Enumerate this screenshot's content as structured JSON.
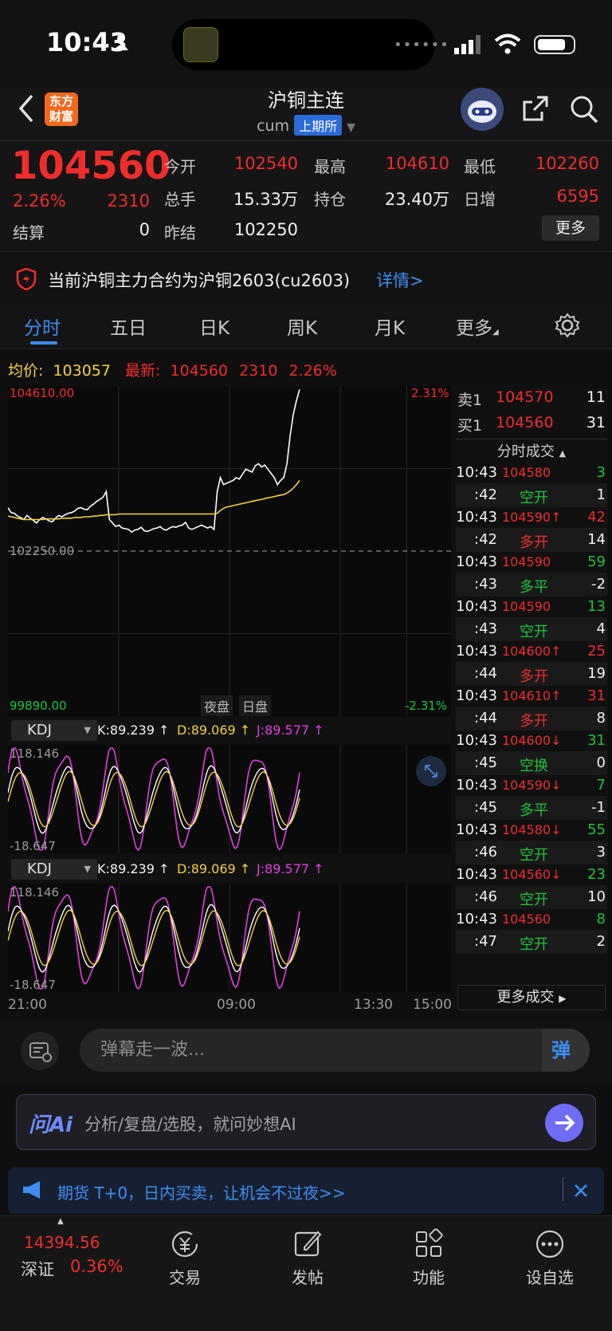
{
  "status_bar": {
    "time": "10:43"
  },
  "header": {
    "title": "沪铜主连",
    "code": "cum",
    "exchange": "上期所",
    "logo_text": "东方财富"
  },
  "quote": {
    "price": "104560",
    "change_pct": "2.26%",
    "change": "2310",
    "settle_label": "结算",
    "settle": "0",
    "fields": [
      {
        "label": "今开",
        "value": "102540"
      },
      {
        "label": "最高",
        "value": "104610"
      },
      {
        "label": "最低",
        "value": "102260"
      },
      {
        "label": "总手",
        "value": "15.33万"
      },
      {
        "label": "持仓",
        "value": "23.40万"
      },
      {
        "label": "日增",
        "value": "6595"
      },
      {
        "label": "昨结",
        "value": "102250"
      }
    ],
    "more_button": "更多"
  },
  "notice": {
    "text": "当前沪铜主力合约为沪铜2603(cu2603)",
    "link": "详情>"
  },
  "tabs": [
    "分时",
    "五日",
    "日K",
    "周K",
    "月K",
    "更多"
  ],
  "price_line": {
    "avg_label": "均价:",
    "avg_value": "103057",
    "latest_label": "最新:",
    "latest_value": "104560",
    "change": "2310",
    "pct": "2.26%"
  },
  "chart_data": {
    "type": "line",
    "y_top": "104610.00",
    "y_mid": "102250.00",
    "y_bottom": "99890.00",
    "pct_top": "2.31%",
    "pct_bottom": "-2.31%",
    "session_labels": [
      "夜盘",
      "日盘"
    ],
    "x_ticks": [
      "21:00",
      "09:00",
      "13:30",
      "15:00"
    ],
    "ylim": [
      99890,
      104610
    ],
    "series": [
      {
        "name": "price",
        "color": "#ffffff",
        "values": [
          102870,
          102800,
          102790,
          102750,
          102730,
          102700,
          102760,
          102720,
          102690,
          102650,
          102700,
          102730,
          102710,
          102680,
          102670,
          102720,
          102760,
          102740,
          102770,
          102790,
          102800,
          102820,
          102860,
          102870,
          102850,
          102840,
          102890,
          102920,
          102960,
          102990,
          103020,
          103100,
          102700,
          102650,
          102600,
          102620,
          102580,
          102570,
          102560,
          102520,
          102550,
          102560,
          102590,
          102540,
          102530,
          102550,
          102570,
          102580,
          102600,
          102560,
          102550,
          102580,
          102600,
          102590,
          102610,
          102620,
          102660,
          102580,
          102560,
          102580,
          102600,
          102620,
          102600,
          102580,
          102600,
          102560,
          103100,
          103300,
          103200,
          103220,
          103240,
          103260,
          103300,
          103280,
          103350,
          103420,
          103400,
          103380,
          103470,
          103500,
          103450,
          103480,
          103420,
          103360,
          103300,
          103200,
          103260,
          103300,
          103500,
          103900,
          104200,
          104400,
          104560
        ]
      },
      {
        "name": "avg",
        "color": "#f5d142",
        "values": [
          102750,
          102740,
          102730,
          102720,
          102710,
          102700,
          102700,
          102700,
          102700,
          102700,
          102700,
          102700,
          102710,
          102710,
          102710,
          102710,
          102710,
          102720,
          102720,
          102720,
          102720,
          102730,
          102730,
          102730,
          102740,
          102740,
          102740,
          102750,
          102750,
          102760,
          102760,
          102770,
          102770,
          102770,
          102770,
          102780,
          102780,
          102780,
          102780,
          102780,
          102780,
          102780,
          102780,
          102780,
          102780,
          102780,
          102780,
          102780,
          102780,
          102780,
          102780,
          102780,
          102780,
          102780,
          102780,
          102780,
          102780,
          102780,
          102780,
          102780,
          102780,
          102780,
          102780,
          102780,
          102780,
          102780,
          102790,
          102830,
          102860,
          102880,
          102890,
          102900,
          102910,
          102920,
          102930,
          102940,
          102950,
          102960,
          102970,
          102980,
          102990,
          103000,
          103010,
          103020,
          103030,
          103040,
          103050,
          103057,
          103080,
          103110,
          103150,
          103200,
          103260
        ]
      }
    ],
    "kdj": {
      "indicator": "KDJ",
      "k": "K:89.239 ↑",
      "d": "D:89.069 ↑",
      "j": "J:89.577 ↑",
      "top": "118.146",
      "bottom": "-18.647"
    }
  },
  "orderbook": [
    {
      "side": "卖1",
      "price": "104570",
      "vol": "11"
    },
    {
      "side": "买1",
      "price": "104560",
      "vol": "31"
    }
  ],
  "trades_title": "分时成交",
  "trades": [
    {
      "time": "10:43",
      "price": "104580",
      "vol": "3",
      "pcolor": "red",
      "vcolor": "green"
    },
    {
      "time": ":42",
      "tag": "空开",
      "vol": "1",
      "tcolor": "green",
      "vcolor": "white"
    },
    {
      "time": "10:43",
      "price": "104590↑",
      "vol": "42",
      "pcolor": "red",
      "vcolor": "red"
    },
    {
      "time": ":42",
      "tag": "多开",
      "vol": "14",
      "tcolor": "red",
      "vcolor": "white"
    },
    {
      "time": "10:43",
      "price": "104590",
      "vol": "59",
      "pcolor": "red",
      "vcolor": "green"
    },
    {
      "time": ":43",
      "tag": "多平",
      "vol": "-2",
      "tcolor": "green",
      "vcolor": "white"
    },
    {
      "time": "10:43",
      "price": "104590",
      "vol": "13",
      "pcolor": "red",
      "vcolor": "green"
    },
    {
      "time": ":43",
      "tag": "空开",
      "vol": "4",
      "tcolor": "green",
      "vcolor": "white"
    },
    {
      "time": "10:43",
      "price": "104600↑",
      "vol": "25",
      "pcolor": "red",
      "vcolor": "red"
    },
    {
      "time": ":44",
      "tag": "多开",
      "vol": "19",
      "tcolor": "red",
      "vcolor": "white"
    },
    {
      "time": "10:43",
      "price": "104610↑",
      "vol": "31",
      "pcolor": "red",
      "vcolor": "red"
    },
    {
      "time": ":44",
      "tag": "多开",
      "vol": "8",
      "tcolor": "red",
      "vcolor": "white"
    },
    {
      "time": "10:43",
      "price": "104600↓",
      "vol": "31",
      "pcolor": "red",
      "vcolor": "green"
    },
    {
      "time": ":45",
      "tag": "空换",
      "vol": "0",
      "tcolor": "green",
      "vcolor": "white"
    },
    {
      "time": "10:43",
      "price": "104590↓",
      "vol": "7",
      "pcolor": "red",
      "vcolor": "green"
    },
    {
      "time": ":45",
      "tag": "多平",
      "vol": "-1",
      "tcolor": "green",
      "vcolor": "white"
    },
    {
      "time": "10:43",
      "price": "104580↓",
      "vol": "55",
      "pcolor": "red",
      "vcolor": "green"
    },
    {
      "time": ":46",
      "tag": "空开",
      "vol": "3",
      "tcolor": "green",
      "vcolor": "white"
    },
    {
      "time": "10:43",
      "price": "104560↓",
      "vol": "23",
      "pcolor": "red",
      "vcolor": "green"
    },
    {
      "time": ":46",
      "tag": "空开",
      "vol": "10",
      "tcolor": "green",
      "vcolor": "white"
    },
    {
      "time": "10:43",
      "price": "104560",
      "vol": "8",
      "pcolor": "red",
      "vcolor": "green"
    },
    {
      "time": ":47",
      "tag": "空开",
      "vol": "2",
      "tcolor": "green",
      "vcolor": "white"
    }
  ],
  "more_trades": "更多成交",
  "danmu_placeholder": "弹幕走一波...",
  "danmu_button": "弹",
  "ai": {
    "logo": "问Ai",
    "placeholder": "分析/复盘/选股，就问妙想AI"
  },
  "ad": {
    "text": "期货 T+0，日内买卖，让机会不过夜>>"
  },
  "bottom_nav": {
    "index_value": "14394.56",
    "index_name": "深证",
    "index_pct": "0.36%",
    "items": [
      "交易",
      "发帖",
      "功能",
      "设自选"
    ]
  }
}
